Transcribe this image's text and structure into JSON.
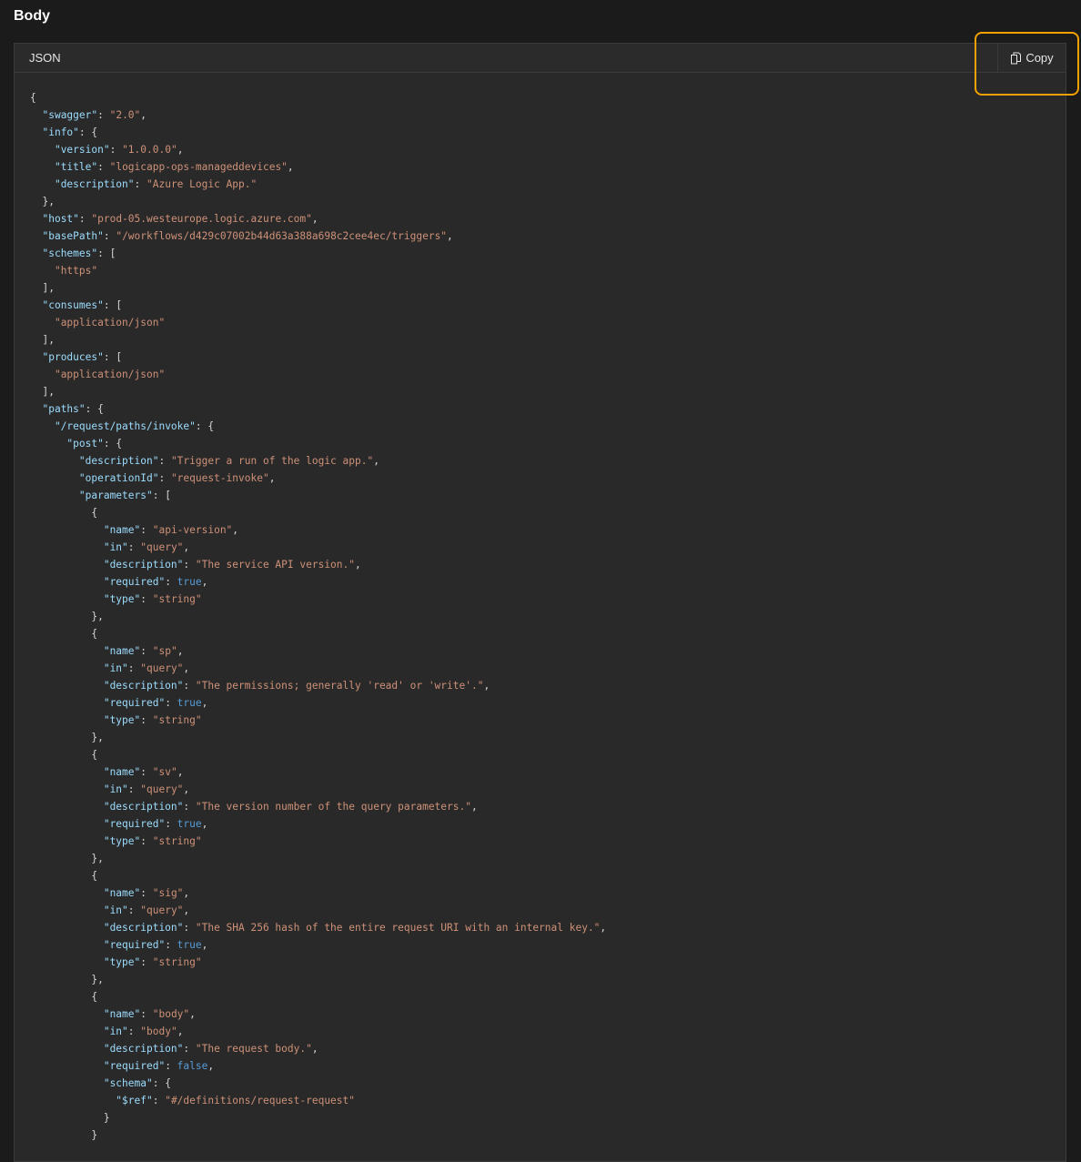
{
  "section": {
    "title": "Body"
  },
  "panel": {
    "language_label": "JSON",
    "copy_label": "Copy"
  },
  "colors": {
    "page_bg": "#1b1b1b",
    "panel_bg": "#292929",
    "key": "#9cdcfe",
    "string": "#ce9178",
    "boolean": "#569cd6",
    "punctuation": "#d4d4d4",
    "highlight": "#f2a200"
  },
  "icons": {
    "copy": "copy-icon"
  },
  "code_lines": [
    [
      {
        "t": "p",
        "v": "{"
      }
    ],
    [
      {
        "t": "p",
        "v": "  "
      },
      {
        "t": "k",
        "v": "\"swagger\""
      },
      {
        "t": "p",
        "v": ": "
      },
      {
        "t": "s",
        "v": "\"2.0\""
      },
      {
        "t": "p",
        "v": ","
      }
    ],
    [
      {
        "t": "p",
        "v": "  "
      },
      {
        "t": "k",
        "v": "\"info\""
      },
      {
        "t": "p",
        "v": ": {"
      }
    ],
    [
      {
        "t": "p",
        "v": "    "
      },
      {
        "t": "k",
        "v": "\"version\""
      },
      {
        "t": "p",
        "v": ": "
      },
      {
        "t": "s",
        "v": "\"1.0.0.0\""
      },
      {
        "t": "p",
        "v": ","
      }
    ],
    [
      {
        "t": "p",
        "v": "    "
      },
      {
        "t": "k",
        "v": "\"title\""
      },
      {
        "t": "p",
        "v": ": "
      },
      {
        "t": "s",
        "v": "\"logicapp-ops-manageddevices\""
      },
      {
        "t": "p",
        "v": ","
      }
    ],
    [
      {
        "t": "p",
        "v": "    "
      },
      {
        "t": "k",
        "v": "\"description\""
      },
      {
        "t": "p",
        "v": ": "
      },
      {
        "t": "s",
        "v": "\"Azure Logic App.\""
      }
    ],
    [
      {
        "t": "p",
        "v": "  },"
      }
    ],
    [
      {
        "t": "p",
        "v": "  "
      },
      {
        "t": "k",
        "v": "\"host\""
      },
      {
        "t": "p",
        "v": ": "
      },
      {
        "t": "s",
        "v": "\"prod-05.westeurope.logic.azure.com\""
      },
      {
        "t": "p",
        "v": ","
      }
    ],
    [
      {
        "t": "p",
        "v": "  "
      },
      {
        "t": "k",
        "v": "\"basePath\""
      },
      {
        "t": "p",
        "v": ": "
      },
      {
        "t": "s",
        "v": "\"/workflows/d429c07002b44d63a388a698c2cee4ec/triggers\""
      },
      {
        "t": "p",
        "v": ","
      }
    ],
    [
      {
        "t": "p",
        "v": "  "
      },
      {
        "t": "k",
        "v": "\"schemes\""
      },
      {
        "t": "p",
        "v": ": ["
      }
    ],
    [
      {
        "t": "p",
        "v": "    "
      },
      {
        "t": "s",
        "v": "\"https\""
      }
    ],
    [
      {
        "t": "p",
        "v": "  ],"
      }
    ],
    [
      {
        "t": "p",
        "v": "  "
      },
      {
        "t": "k",
        "v": "\"consumes\""
      },
      {
        "t": "p",
        "v": ": ["
      }
    ],
    [
      {
        "t": "p",
        "v": "    "
      },
      {
        "t": "s",
        "v": "\"application/json\""
      }
    ],
    [
      {
        "t": "p",
        "v": "  ],"
      }
    ],
    [
      {
        "t": "p",
        "v": "  "
      },
      {
        "t": "k",
        "v": "\"produces\""
      },
      {
        "t": "p",
        "v": ": ["
      }
    ],
    [
      {
        "t": "p",
        "v": "    "
      },
      {
        "t": "s",
        "v": "\"application/json\""
      }
    ],
    [
      {
        "t": "p",
        "v": "  ],"
      }
    ],
    [
      {
        "t": "p",
        "v": "  "
      },
      {
        "t": "k",
        "v": "\"paths\""
      },
      {
        "t": "p",
        "v": ": {"
      }
    ],
    [
      {
        "t": "p",
        "v": "    "
      },
      {
        "t": "k",
        "v": "\"/request/paths/invoke\""
      },
      {
        "t": "p",
        "v": ": {"
      }
    ],
    [
      {
        "t": "p",
        "v": "      "
      },
      {
        "t": "k",
        "v": "\"post\""
      },
      {
        "t": "p",
        "v": ": {"
      }
    ],
    [
      {
        "t": "p",
        "v": "        "
      },
      {
        "t": "k",
        "v": "\"description\""
      },
      {
        "t": "p",
        "v": ": "
      },
      {
        "t": "s",
        "v": "\"Trigger a run of the logic app.\""
      },
      {
        "t": "p",
        "v": ","
      }
    ],
    [
      {
        "t": "p",
        "v": "        "
      },
      {
        "t": "k",
        "v": "\"operationId\""
      },
      {
        "t": "p",
        "v": ": "
      },
      {
        "t": "s",
        "v": "\"request-invoke\""
      },
      {
        "t": "p",
        "v": ","
      }
    ],
    [
      {
        "t": "p",
        "v": "        "
      },
      {
        "t": "k",
        "v": "\"parameters\""
      },
      {
        "t": "p",
        "v": ": ["
      }
    ],
    [
      {
        "t": "p",
        "v": "          {"
      }
    ],
    [
      {
        "t": "p",
        "v": "            "
      },
      {
        "t": "k",
        "v": "\"name\""
      },
      {
        "t": "p",
        "v": ": "
      },
      {
        "t": "s",
        "v": "\"api-version\""
      },
      {
        "t": "p",
        "v": ","
      }
    ],
    [
      {
        "t": "p",
        "v": "            "
      },
      {
        "t": "k",
        "v": "\"in\""
      },
      {
        "t": "p",
        "v": ": "
      },
      {
        "t": "s",
        "v": "\"query\""
      },
      {
        "t": "p",
        "v": ","
      }
    ],
    [
      {
        "t": "p",
        "v": "            "
      },
      {
        "t": "k",
        "v": "\"description\""
      },
      {
        "t": "p",
        "v": ": "
      },
      {
        "t": "s",
        "v": "\"The service API version.\""
      },
      {
        "t": "p",
        "v": ","
      }
    ],
    [
      {
        "t": "p",
        "v": "            "
      },
      {
        "t": "k",
        "v": "\"required\""
      },
      {
        "t": "p",
        "v": ": "
      },
      {
        "t": "b",
        "v": "true"
      },
      {
        "t": "p",
        "v": ","
      }
    ],
    [
      {
        "t": "p",
        "v": "            "
      },
      {
        "t": "k",
        "v": "\"type\""
      },
      {
        "t": "p",
        "v": ": "
      },
      {
        "t": "s",
        "v": "\"string\""
      }
    ],
    [
      {
        "t": "p",
        "v": "          },"
      }
    ],
    [
      {
        "t": "p",
        "v": "          {"
      }
    ],
    [
      {
        "t": "p",
        "v": "            "
      },
      {
        "t": "k",
        "v": "\"name\""
      },
      {
        "t": "p",
        "v": ": "
      },
      {
        "t": "s",
        "v": "\"sp\""
      },
      {
        "t": "p",
        "v": ","
      }
    ],
    [
      {
        "t": "p",
        "v": "            "
      },
      {
        "t": "k",
        "v": "\"in\""
      },
      {
        "t": "p",
        "v": ": "
      },
      {
        "t": "s",
        "v": "\"query\""
      },
      {
        "t": "p",
        "v": ","
      }
    ],
    [
      {
        "t": "p",
        "v": "            "
      },
      {
        "t": "k",
        "v": "\"description\""
      },
      {
        "t": "p",
        "v": ": "
      },
      {
        "t": "s",
        "v": "\"The permissions; generally 'read' or 'write'.\""
      },
      {
        "t": "p",
        "v": ","
      }
    ],
    [
      {
        "t": "p",
        "v": "            "
      },
      {
        "t": "k",
        "v": "\"required\""
      },
      {
        "t": "p",
        "v": ": "
      },
      {
        "t": "b",
        "v": "true"
      },
      {
        "t": "p",
        "v": ","
      }
    ],
    [
      {
        "t": "p",
        "v": "            "
      },
      {
        "t": "k",
        "v": "\"type\""
      },
      {
        "t": "p",
        "v": ": "
      },
      {
        "t": "s",
        "v": "\"string\""
      }
    ],
    [
      {
        "t": "p",
        "v": "          },"
      }
    ],
    [
      {
        "t": "p",
        "v": "          {"
      }
    ],
    [
      {
        "t": "p",
        "v": "            "
      },
      {
        "t": "k",
        "v": "\"name\""
      },
      {
        "t": "p",
        "v": ": "
      },
      {
        "t": "s",
        "v": "\"sv\""
      },
      {
        "t": "p",
        "v": ","
      }
    ],
    [
      {
        "t": "p",
        "v": "            "
      },
      {
        "t": "k",
        "v": "\"in\""
      },
      {
        "t": "p",
        "v": ": "
      },
      {
        "t": "s",
        "v": "\"query\""
      },
      {
        "t": "p",
        "v": ","
      }
    ],
    [
      {
        "t": "p",
        "v": "            "
      },
      {
        "t": "k",
        "v": "\"description\""
      },
      {
        "t": "p",
        "v": ": "
      },
      {
        "t": "s",
        "v": "\"The version number of the query parameters.\""
      },
      {
        "t": "p",
        "v": ","
      }
    ],
    [
      {
        "t": "p",
        "v": "            "
      },
      {
        "t": "k",
        "v": "\"required\""
      },
      {
        "t": "p",
        "v": ": "
      },
      {
        "t": "b",
        "v": "true"
      },
      {
        "t": "p",
        "v": ","
      }
    ],
    [
      {
        "t": "p",
        "v": "            "
      },
      {
        "t": "k",
        "v": "\"type\""
      },
      {
        "t": "p",
        "v": ": "
      },
      {
        "t": "s",
        "v": "\"string\""
      }
    ],
    [
      {
        "t": "p",
        "v": "          },"
      }
    ],
    [
      {
        "t": "p",
        "v": "          {"
      }
    ],
    [
      {
        "t": "p",
        "v": "            "
      },
      {
        "t": "k",
        "v": "\"name\""
      },
      {
        "t": "p",
        "v": ": "
      },
      {
        "t": "s",
        "v": "\"sig\""
      },
      {
        "t": "p",
        "v": ","
      }
    ],
    [
      {
        "t": "p",
        "v": "            "
      },
      {
        "t": "k",
        "v": "\"in\""
      },
      {
        "t": "p",
        "v": ": "
      },
      {
        "t": "s",
        "v": "\"query\""
      },
      {
        "t": "p",
        "v": ","
      }
    ],
    [
      {
        "t": "p",
        "v": "            "
      },
      {
        "t": "k",
        "v": "\"description\""
      },
      {
        "t": "p",
        "v": ": "
      },
      {
        "t": "s",
        "v": "\"The SHA 256 hash of the entire request URI with an internal key.\""
      },
      {
        "t": "p",
        "v": ","
      }
    ],
    [
      {
        "t": "p",
        "v": "            "
      },
      {
        "t": "k",
        "v": "\"required\""
      },
      {
        "t": "p",
        "v": ": "
      },
      {
        "t": "b",
        "v": "true"
      },
      {
        "t": "p",
        "v": ","
      }
    ],
    [
      {
        "t": "p",
        "v": "            "
      },
      {
        "t": "k",
        "v": "\"type\""
      },
      {
        "t": "p",
        "v": ": "
      },
      {
        "t": "s",
        "v": "\"string\""
      }
    ],
    [
      {
        "t": "p",
        "v": "          },"
      }
    ],
    [
      {
        "t": "p",
        "v": "          {"
      }
    ],
    [
      {
        "t": "p",
        "v": "            "
      },
      {
        "t": "k",
        "v": "\"name\""
      },
      {
        "t": "p",
        "v": ": "
      },
      {
        "t": "s",
        "v": "\"body\""
      },
      {
        "t": "p",
        "v": ","
      }
    ],
    [
      {
        "t": "p",
        "v": "            "
      },
      {
        "t": "k",
        "v": "\"in\""
      },
      {
        "t": "p",
        "v": ": "
      },
      {
        "t": "s",
        "v": "\"body\""
      },
      {
        "t": "p",
        "v": ","
      }
    ],
    [
      {
        "t": "p",
        "v": "            "
      },
      {
        "t": "k",
        "v": "\"description\""
      },
      {
        "t": "p",
        "v": ": "
      },
      {
        "t": "s",
        "v": "\"The request body.\""
      },
      {
        "t": "p",
        "v": ","
      }
    ],
    [
      {
        "t": "p",
        "v": "            "
      },
      {
        "t": "k",
        "v": "\"required\""
      },
      {
        "t": "p",
        "v": ": "
      },
      {
        "t": "b",
        "v": "false"
      },
      {
        "t": "p",
        "v": ","
      }
    ],
    [
      {
        "t": "p",
        "v": "            "
      },
      {
        "t": "k",
        "v": "\"schema\""
      },
      {
        "t": "p",
        "v": ": {"
      }
    ],
    [
      {
        "t": "p",
        "v": "              "
      },
      {
        "t": "k",
        "v": "\"$ref\""
      },
      {
        "t": "p",
        "v": ": "
      },
      {
        "t": "s",
        "v": "\"#/definitions/request-request\""
      }
    ],
    [
      {
        "t": "p",
        "v": "            }"
      }
    ],
    [
      {
        "t": "p",
        "v": "          }"
      }
    ]
  ]
}
